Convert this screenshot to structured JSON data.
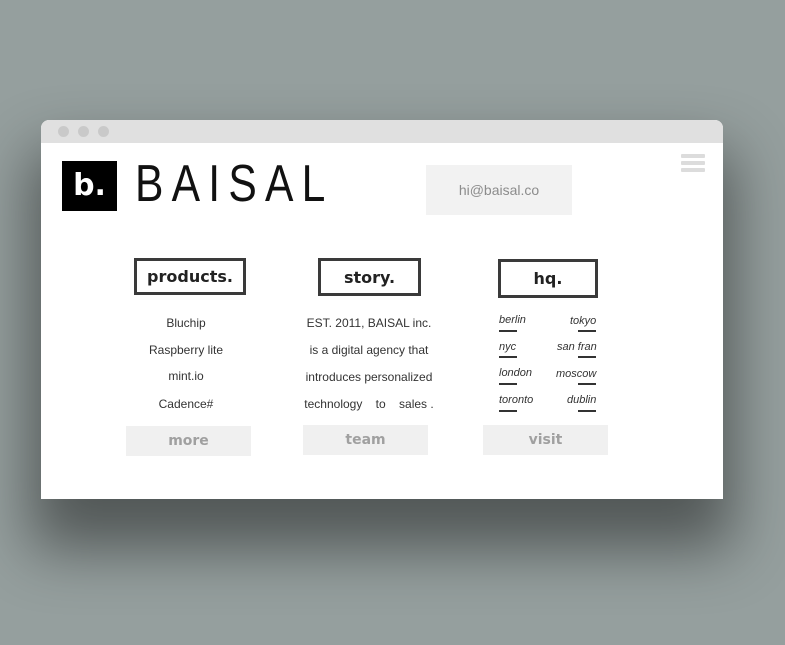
{
  "brand": {
    "mark": "b.",
    "name": "BAISAL"
  },
  "header": {
    "email": "hi@baisal.co"
  },
  "sections": {
    "products": {
      "title": "products.",
      "items": [
        "Bluchip",
        "Raspberry lite",
        "mint.io",
        "Cadence#"
      ],
      "button": "more"
    },
    "story": {
      "title": "story.",
      "lines": [
        "EST. 2011, BAISAL inc.",
        "is a digital agency that",
        "introduces personalized",
        "technology    to    sales ."
      ],
      "button": "team"
    },
    "hq": {
      "title": "hq.",
      "cities": [
        [
          "berlin",
          "tokyo"
        ],
        [
          "nyc",
          "san fran"
        ],
        [
          "london",
          "moscow"
        ],
        [
          "toronto",
          "dublin"
        ]
      ],
      "button": "visit"
    }
  },
  "colors": {
    "background": "#959f9e",
    "window": "#ffffff",
    "titlebar": "#e0e0e0",
    "accent": "#000000"
  },
  "icons": [
    "window-dot-icon",
    "hamburger-menu-icon"
  ]
}
